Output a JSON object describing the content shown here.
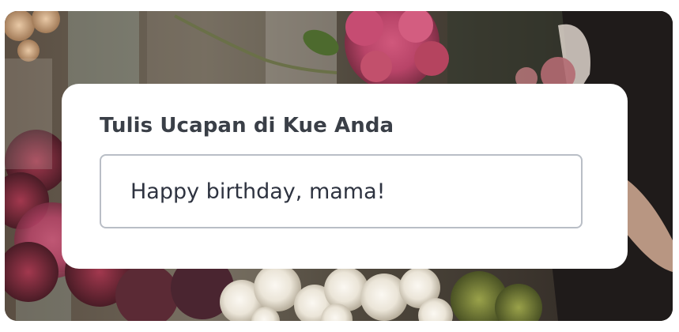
{
  "form": {
    "label": "Tulis Ucapan di Kue Anda",
    "message_value": "Happy birthday, mama!",
    "message_placeholder": ""
  },
  "background": {
    "subject": "flower bouquets photo"
  },
  "colors": {
    "card": "#ffffff",
    "label_text": "#3a3f47",
    "input_border": "#b9bec6",
    "input_text": "#2e3340"
  }
}
